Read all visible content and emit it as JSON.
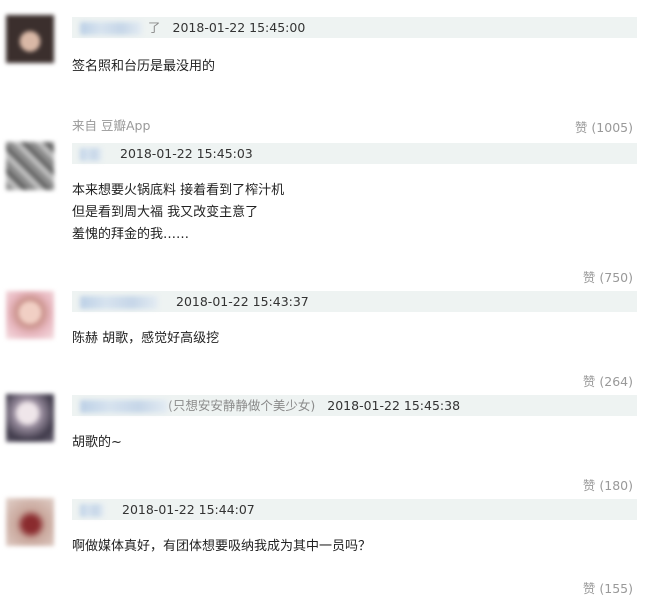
{
  "comments": [
    {
      "name_suffix": "了",
      "time": "2018-01-22 15:45:00",
      "lines": [
        "签名照和台历是最没用的"
      ],
      "source": "来自 豆瓣App",
      "likes": "赞 (1005)"
    },
    {
      "name_suffix": "",
      "time": "2018-01-22 15:45:03",
      "lines": [
        "本来想要火锅底料 接着看到了榨汁机",
        "但是看到周大福 我又改变主意了",
        "羞愧的拜金的我……"
      ],
      "likes": "赞 (750)"
    },
    {
      "name_suffix": "",
      "time": "2018-01-22 15:43:37",
      "lines": [
        "陈赫 胡歌，感觉好高级挖"
      ],
      "likes": "赞 (264)"
    },
    {
      "name_suffix": "(只想安安静静做个美少女)",
      "time": "2018-01-22 15:45:38",
      "lines": [
        "胡歌的~"
      ],
      "likes": "赞 (180)"
    },
    {
      "name_suffix": "",
      "time": "2018-01-22 15:44:07",
      "lines": [
        "啊做媒体真好，有团体想要吸纳我成为其中一员吗？"
      ],
      "likes": "赞 (155)"
    }
  ]
}
